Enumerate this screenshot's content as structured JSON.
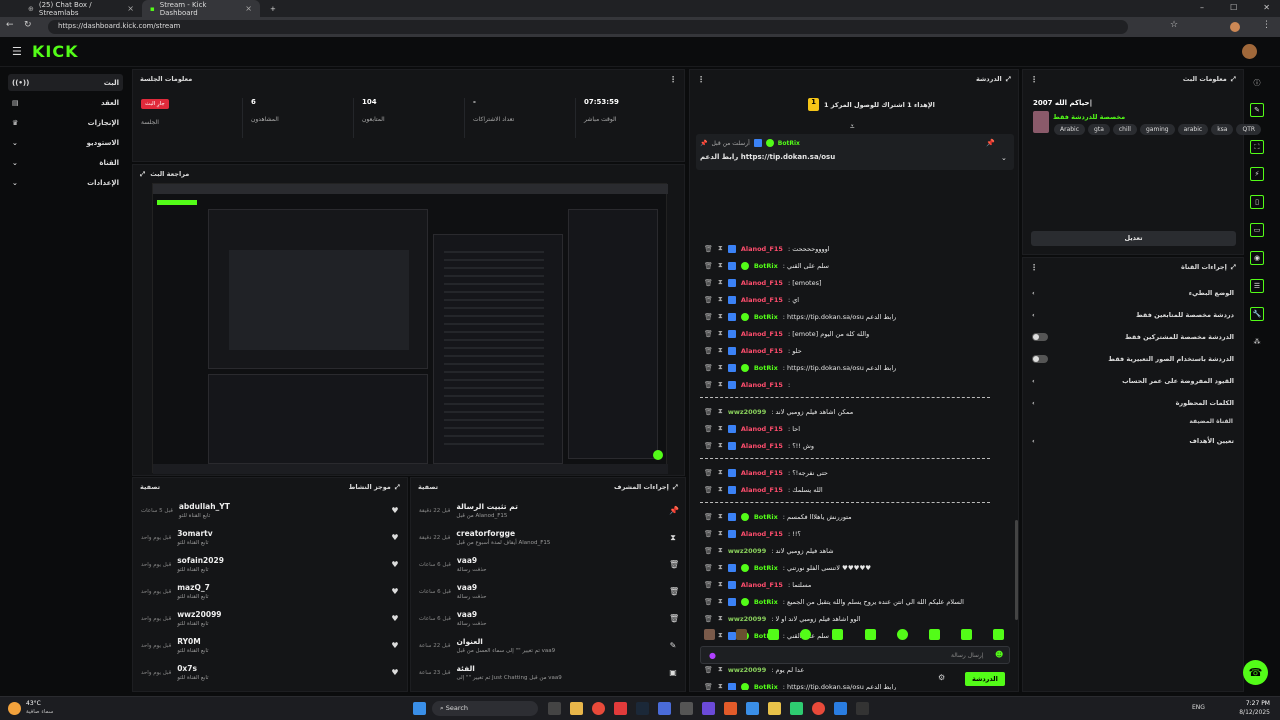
{
  "browser": {
    "tabs": [
      {
        "title": "(25) Chat Box / Streamlabs"
      },
      {
        "title": "Stream - Kick Dashboard"
      }
    ],
    "url": "https://dashboard.kick.com/stream"
  },
  "kick": {
    "logo": "KICK"
  },
  "leftnav": {
    "items": [
      {
        "label": "البث",
        "icon": "live-icon"
      },
      {
        "label": "العقد",
        "icon": "contract-icon"
      },
      {
        "label": "الإنجازات",
        "icon": "trophy-icon"
      },
      {
        "label": "الاستوديو",
        "icon": "studio-icon"
      },
      {
        "label": "القناة",
        "icon": "channel-icon"
      },
      {
        "label": "الإعدادات",
        "icon": "settings-icon"
      }
    ]
  },
  "session": {
    "title": "معلومات الجلسة",
    "stats": [
      {
        "value": "جارِ البث",
        "label": "الجلسة"
      },
      {
        "value": "6",
        "label": "المشاهدون"
      },
      {
        "value": "104",
        "label": "المتابعون"
      },
      {
        "value": "-",
        "label": "تعداد الاشتراكات"
      },
      {
        "value": "07:53:59",
        "label": "الوقت مباشر"
      }
    ]
  },
  "preview": {
    "title": "مراجعة البث"
  },
  "activity": {
    "title": "موجز النشاط",
    "filter": "تصفية",
    "items": [
      {
        "name": "abdullah_YT",
        "sub": "تابع القناة للتو",
        "time": "قبل 5 ساعات"
      },
      {
        "name": "3omartv",
        "sub": "تابع القناة للتو",
        "time": "قبل يوم واحد"
      },
      {
        "name": "sofain2029",
        "sub": "تابع القناة للتو",
        "time": "قبل يوم واحد"
      },
      {
        "name": "mazQ_7",
        "sub": "تابع القناة للتو",
        "time": "قبل يوم واحد"
      },
      {
        "name": "wwz20099",
        "sub": "تابع القناة للتو",
        "time": "قبل يوم واحد"
      },
      {
        "name": "RY0M",
        "sub": "تابع القناة للتو",
        "time": "قبل يوم واحد"
      },
      {
        "name": "0x7s",
        "sub": "تابع القناة للتو",
        "time": "قبل يوم واحد"
      }
    ]
  },
  "modactions": {
    "title": "إجراءات المشرف",
    "filter": "تصفية",
    "items": [
      {
        "icon": "pin-icon",
        "name": "تم تثبيت الرسالة",
        "sub": "من قبل Alanod_F15",
        "time": "قبل 22 دقيقة"
      },
      {
        "icon": "timeout-icon",
        "name": "creatorforgge",
        "sub": "أيقاف لمدة أسبوع من قبل Alanod_F15",
        "time": "قبل 22 دقيقة"
      },
      {
        "icon": "trash-icon",
        "name": "vaa9",
        "sub": "حذفت رسالة",
        "time": "قبل 6 ساعات"
      },
      {
        "icon": "trash-icon",
        "name": "vaa9",
        "sub": "حذفت رسالة",
        "time": "قبل 6 ساعات"
      },
      {
        "icon": "trash-icon",
        "name": "vaa9",
        "sub": "حذفت رسالة",
        "time": "قبل 6 ساعات"
      },
      {
        "icon": "edit-icon",
        "name": "العنوان",
        "sub": "تم تغيير \"\" إلى سماء العسل من قبل vaa9",
        "time": "قبل 22 ساعة"
      },
      {
        "icon": "category-icon",
        "name": "الفئة",
        "sub": "تم تغيير \"\" إلى Just Chatting من قبل vaa9",
        "time": "قبل 23 ساعة"
      }
    ]
  },
  "chat": {
    "title": "الدردشة",
    "goal_text": "الإهداء 1 اشتراك للوصول المركز 1",
    "pinned": {
      "user": "BotRix",
      "label": "أرسلت من قبل",
      "text": "رابط الدعم https://tip.dokan.sa/osu"
    },
    "messages": [
      {
        "user": "Alanod_F15",
        "cls": "u-pink",
        "text": ": اووووححححت"
      },
      {
        "user": "BotRix",
        "cls": "u-green",
        "text": ": سلم على القني"
      },
      {
        "user": "Alanod_F15",
        "cls": "u-pink",
        "text": ": [emotes]"
      },
      {
        "user": "Alanod_F15",
        "cls": "u-pink",
        "text": ": اي"
      },
      {
        "user": "BotRix",
        "cls": "u-green",
        "text": ": https://tip.dokan.sa/osu رابط الدعم"
      },
      {
        "user": "Alanod_F15",
        "cls": "u-pink",
        "text": ": [emote] والله كله من اليوم"
      },
      {
        "user": "Alanod_F15",
        "cls": "u-pink",
        "text": ": حلو"
      },
      {
        "user": "BotRix",
        "cls": "u-green",
        "text": ": https://tip.dokan.sa/osu رابط الدعم"
      },
      {
        "user": "Alanod_F15",
        "cls": "u-pink",
        "text": ":"
      },
      {
        "user": "wwz20099",
        "cls": "u-lg",
        "text": ": ممكن اشاهد فيلم زومبي لاند"
      },
      {
        "user": "Alanod_F15",
        "cls": "u-pink",
        "text": ": احا"
      },
      {
        "user": "Alanod_F15",
        "cls": "u-pink",
        "text": ": وش !!؟"
      },
      {
        "user": "Alanod_F15",
        "cls": "u-pink",
        "text": ": حتى نفرجه!؟"
      },
      {
        "user": "Alanod_F15",
        "cls": "u-pink",
        "text": ": الله يسلمك"
      },
      {
        "user": "BotRix",
        "cls": "u-green",
        "text": ": متوررنش ياهلااا فكمسم"
      },
      {
        "user": "Alanod_F15",
        "cls": "u-pink",
        "text": ": !!؟"
      },
      {
        "user": "wwz20099",
        "cls": "u-lg",
        "text": ": شاهد فيلم زومبي لاند"
      },
      {
        "user": "BotRix",
        "cls": "u-green",
        "text": ": لاتنسى الفلو نورتني ♥♥♥♥♥"
      },
      {
        "user": "Alanod_F15",
        "cls": "u-pink",
        "text": ": مسلتما"
      },
      {
        "user": "BotRix",
        "cls": "u-green",
        "text": ": السلام عليكم الله الي انتن عنده يروح يسلم والله يتقبل من الجميع"
      },
      {
        "user": "wwz20099",
        "cls": "u-lg",
        "text": ": الوو اشاهد فيلم زومبي لاند او لا"
      },
      {
        "user": "BotRix",
        "cls": "u-green",
        "text": ": سلم على القني"
      },
      {
        "user": "wwz20099",
        "cls": "u-lg",
        "text": ": ابغى رد على في رسالة"
      },
      {
        "user": "wwz20099",
        "cls": "u-lg",
        "text": ": عدا لم يوم"
      },
      {
        "user": "BotRix",
        "cls": "u-green",
        "text": ": https://tip.dokan.sa/osu رابط الدعم"
      }
    ],
    "input_placeholder": "إرسال رسالة",
    "send_label": "الدردشة"
  },
  "streaminfo": {
    "title": "معلومات البث",
    "stream_title": "حياكم الله 2007|",
    "category": "مخصصة للدردشة فقط",
    "tags": [
      "Arabic",
      "gta",
      "chill",
      "gaming",
      "arabic",
      "ksa",
      "QTR"
    ],
    "edit_label": "تعديل"
  },
  "channelactions": {
    "title": "إجراءات القناة",
    "rows": [
      {
        "label": "الوضع البطيء",
        "kind": "chevron"
      },
      {
        "label": "دردشة مخصصة للمتابعين فقط",
        "kind": "chevron"
      },
      {
        "label": "الدردشة مخصصة للمشتركين فقط",
        "kind": "toggle"
      },
      {
        "label": "الدردشة باستخدام الصور التعبيرية فقط",
        "kind": "toggle"
      },
      {
        "label": "القيود المفروضة على عمر الحساب",
        "kind": "chevron"
      },
      {
        "label": "الكلمات المحظورة",
        "kind": "chevron"
      }
    ],
    "section2": "القناة المضيفة",
    "goals_label": "تعيين الأهداف"
  },
  "taskbar": {
    "weather_temp": "43°C",
    "weather_desc": "سماء صافية",
    "search": "Search",
    "lang": "ENG",
    "time": "7:27 PM",
    "date": "8/12/2025"
  }
}
